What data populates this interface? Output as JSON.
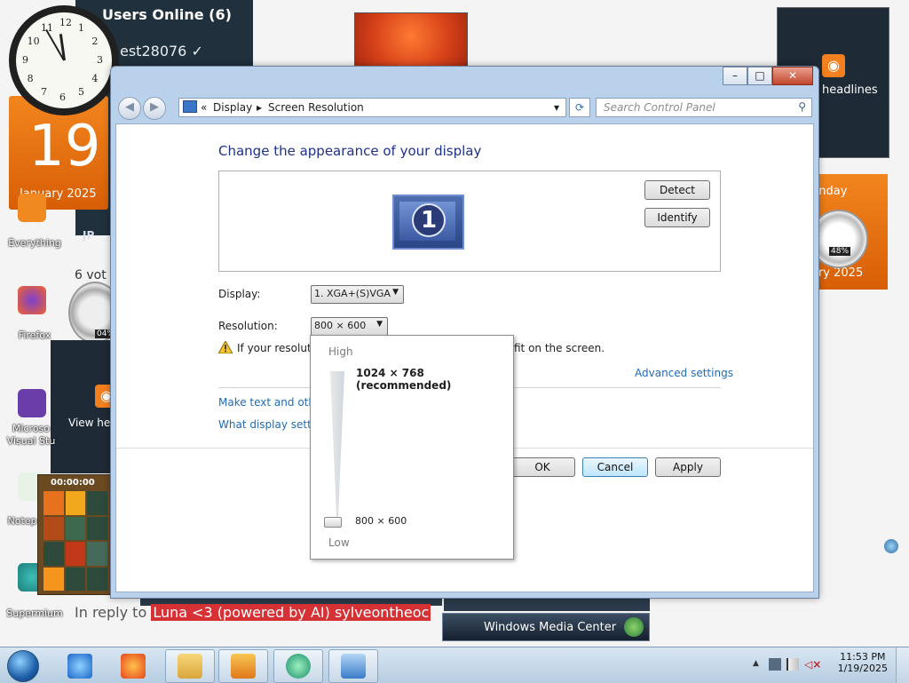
{
  "desktop": {
    "users_panel": {
      "title": "Users Online (6)",
      "user": "est28076 ✓",
      "initials": "JP"
    },
    "calendar_left": {
      "day": "19",
      "month": "January 2025"
    },
    "calendar_right": {
      "weekday": "unday",
      "month": "ary 2025",
      "gauge_pct": "48%"
    },
    "rss_right": {
      "label": "headlines"
    },
    "rss_left": {
      "label": "View he"
    },
    "gauge_left_pct": "04%",
    "votes": "6 vot",
    "icons": [
      {
        "name": "Everything"
      },
      {
        "name": "Firefox"
      },
      {
        "name": "Microso\nVisual Stu"
      },
      {
        "name": "Notep"
      },
      {
        "name": "Supermium"
      }
    ],
    "tiles_timer": "00:00:00",
    "reply": {
      "prefix": "In reply to",
      "highlight": "Luna <3 (powered by AI) sylveontheoc"
    },
    "wmc_label": "Windows Media Center",
    "clock_numbers": [
      "12",
      "1",
      "2",
      "3",
      "4",
      "5",
      "6",
      "7",
      "8",
      "9",
      "10",
      "11"
    ]
  },
  "window": {
    "controls": {
      "minimize": "–",
      "maximize": "□",
      "close": "✕"
    },
    "breadcrumb": {
      "chevrons": "«",
      "display": "Display",
      "arrow": "▸",
      "current": "Screen Resolution",
      "dropdown": "▾"
    },
    "search_placeholder": "Search Control Panel",
    "heading": "Change the appearance of your display",
    "monitor_number": "1",
    "detect_label": "Detect",
    "identify_label": "Identify",
    "display_label": "Display:",
    "display_value": "1. XGA+(S)VGA",
    "resolution_label": "Resolution:",
    "resolution_value": "800 × 600",
    "warning_text_start": "If your resolutio",
    "warning_text_end": "fit on the screen.",
    "advanced_link": "Advanced settings",
    "link_text_size": "Make text and other",
    "link_display_settings": "What display setting",
    "ok_label": "OK",
    "cancel_label": "Cancel",
    "apply_label": "Apply"
  },
  "resolution_popup": {
    "high_label": "High",
    "low_label": "Low",
    "max_resolution": "1024 × 768 (recommended)",
    "current_resolution": "800 × 600",
    "slider_level": 0
  },
  "taskbar": {
    "time": "11:53 PM",
    "date": "1/19/2025",
    "pinned": [
      "Internet Explorer",
      "Firefox",
      "File Explorer",
      "Media Player",
      "Media Center",
      "Control Panel"
    ]
  },
  "colors": {
    "accent_blue": "#1e3287",
    "link_blue": "#1f6bb5",
    "calendar_orange": "#f2851e"
  }
}
